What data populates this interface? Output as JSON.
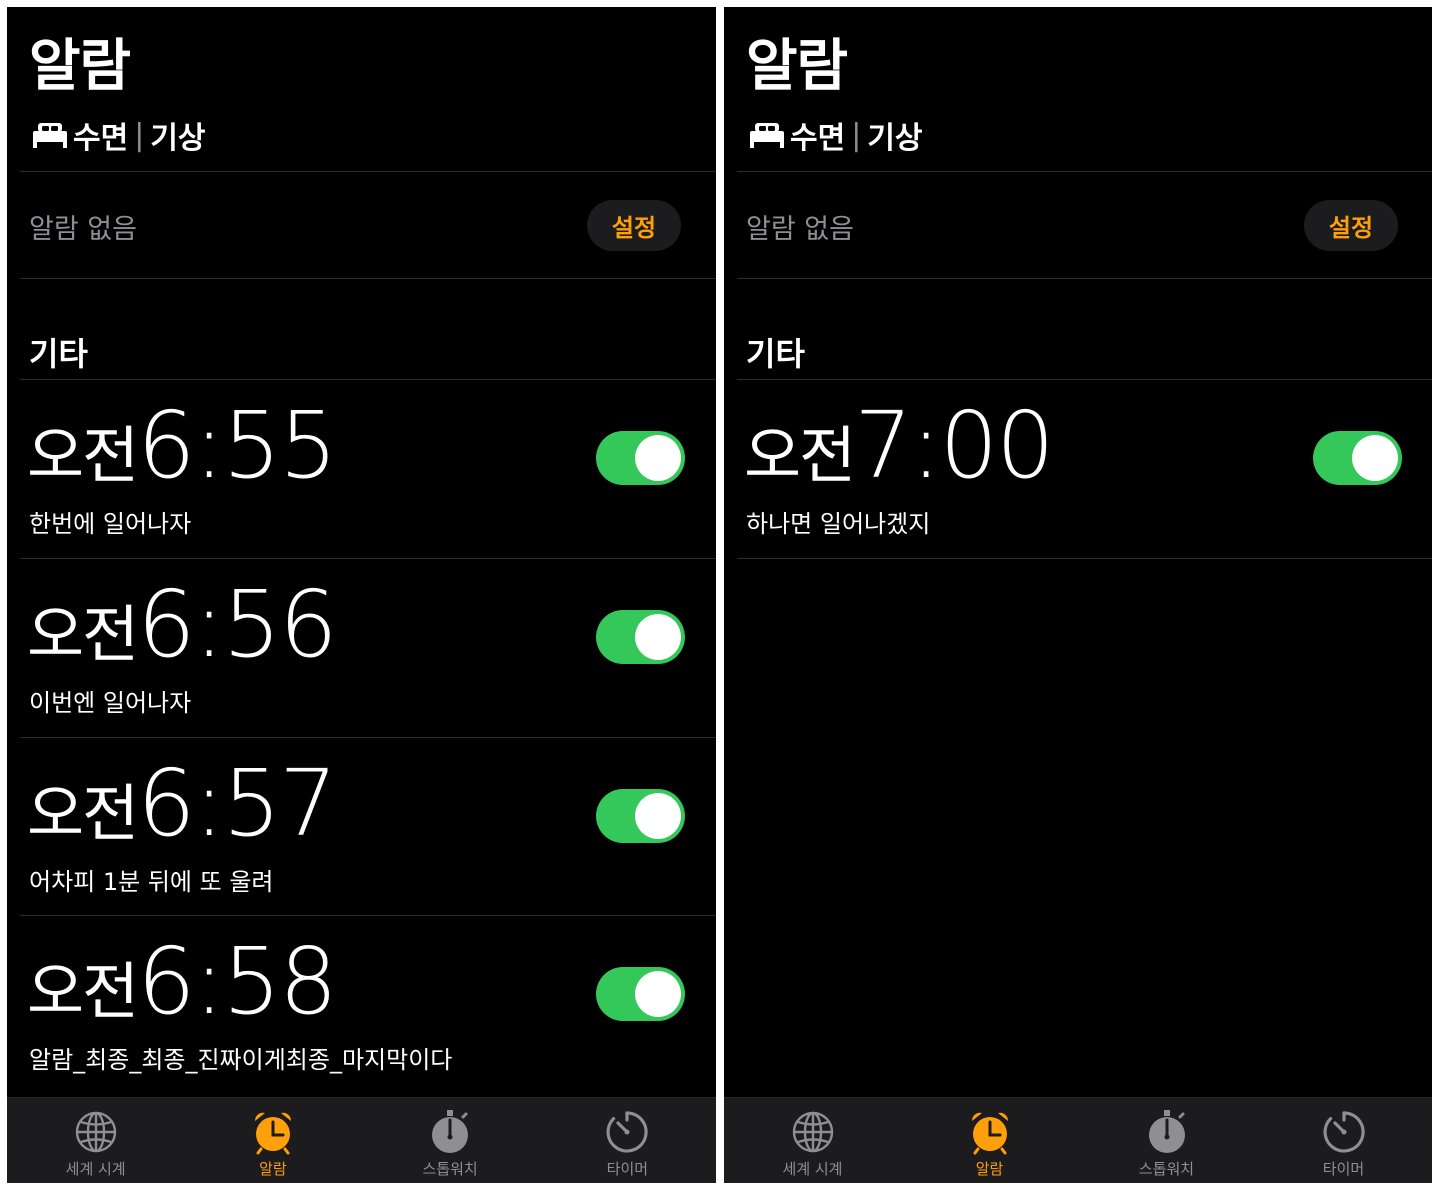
{
  "screens": [
    {
      "title": "알람",
      "sleep": {
        "part1": "수면",
        "separator": "|",
        "part2": "기상"
      },
      "no_alarm": "알람 없음",
      "setup_label": "설정",
      "section_title": "기타",
      "alarms": [
        {
          "ampm": "오전",
          "time": "6:55",
          "label": "한번에 일어나자",
          "enabled": true
        },
        {
          "ampm": "오전",
          "time": "6:56",
          "label": "이번엔 일어나자",
          "enabled": true
        },
        {
          "ampm": "오전",
          "time": "6:57",
          "label": "어차피 1분 뒤에 또 울려",
          "enabled": true
        },
        {
          "ampm": "오전",
          "time": "6:58",
          "label": "알람_최종_최종_진짜이게최종_마지막이다",
          "enabled": true
        }
      ]
    },
    {
      "title": "알람",
      "sleep": {
        "part1": "수면",
        "separator": "|",
        "part2": "기상"
      },
      "no_alarm": "알람 없음",
      "setup_label": "설정",
      "section_title": "기타",
      "alarms": [
        {
          "ampm": "오전",
          "time": "7:00",
          "label": "하나면 일어나겠지",
          "enabled": true
        }
      ]
    }
  ],
  "tabs": [
    {
      "label": "세계 시계",
      "icon": "globe-icon",
      "active": false
    },
    {
      "label": "알람",
      "icon": "alarm-clock-icon",
      "active": true
    },
    {
      "label": "스톱워치",
      "icon": "stopwatch-icon",
      "active": false
    },
    {
      "label": "타이머",
      "icon": "timer-icon",
      "active": false
    }
  ],
  "colors": {
    "background": "#000000",
    "accent": "#ff9f0a",
    "toggle_on": "#34c759",
    "secondary_text": "#8e8e93",
    "tabbar": "#1c1c1e"
  }
}
